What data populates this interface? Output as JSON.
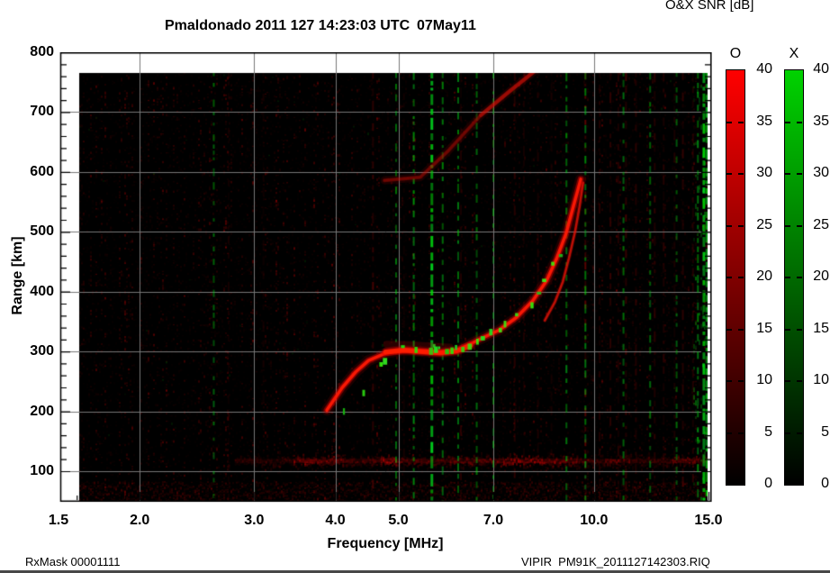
{
  "header": {
    "title_left": "Pmaldonado 2011 127 14:23:03 UTC",
    "title_right": "07May11",
    "snr_title": "O&X SNR [dB]"
  },
  "footer": {
    "left": "RxMask 00001111",
    "right": "VIPIR  PM91K_2011127142303.RIQ"
  },
  "chart_data": {
    "type": "heatmap",
    "title": "Pmaldonado 2011 127 14:23:03 UTC   07May11",
    "xlabel": "Frequency [MHz]",
    "ylabel": "Range [km]",
    "x_scale": "log",
    "x_range": [
      1.5,
      15.15
    ],
    "y_range": [
      49,
      800
    ],
    "x_ticks": [
      {
        "v": 1.5,
        "label": "1.5"
      },
      {
        "v": 2,
        "label": "2.0"
      },
      {
        "v": 3,
        "label": "3.0"
      },
      {
        "v": 4,
        "label": "4.0"
      },
      {
        "v": 5,
        "label": "5.0"
      },
      {
        "v": 7,
        "label": "7.0"
      },
      {
        "v": 10,
        "label": "10.0"
      },
      {
        "v": 15,
        "label": "15.0"
      }
    ],
    "x_minor_ticks": [
      1.6,
      1.7,
      1.8,
      1.9,
      2.2,
      2.4,
      2.6,
      2.8,
      3.2,
      3.4,
      3.6,
      3.8,
      4.2,
      4.4,
      4.6,
      4.8,
      5.5,
      6,
      6.5,
      7.5,
      8,
      8.5,
      9,
      9.5,
      11,
      12,
      13,
      14
    ],
    "y_ticks": [
      800,
      700,
      600,
      500,
      400,
      300,
      200,
      100
    ],
    "y_minor_step": 20,
    "grid": true,
    "grid_color": "#777777",
    "background_color": "#000000",
    "data_extent": {
      "f_min": 1.61,
      "f_max": 14.92,
      "km_min": 49,
      "km_max": 765
    },
    "colorbar": {
      "title_o": "O",
      "title_x": "X",
      "unit": "dB",
      "min": 0,
      "max": 40,
      "ticks": [
        40,
        35,
        30,
        25,
        20,
        15,
        10,
        5,
        0
      ],
      "o_top_color": "#ff0000",
      "x_top_color": "#00d200",
      "bottom_color": "#000000"
    },
    "traces": {
      "f_layer_o_mode": [
        [
          3.88,
          202
        ],
        [
          4.1,
          240
        ],
        [
          4.3,
          266
        ],
        [
          4.5,
          285
        ],
        [
          4.8,
          298
        ],
        [
          5.1,
          302
        ],
        [
          5.45,
          300
        ],
        [
          5.8,
          298
        ],
        [
          6.15,
          301
        ],
        [
          6.6,
          318
        ],
        [
          7.15,
          336
        ],
        [
          7.6,
          357
        ],
        [
          8.05,
          385
        ],
        [
          8.45,
          418
        ],
        [
          8.75,
          454
        ],
        [
          9.05,
          496
        ],
        [
          9.27,
          538
        ],
        [
          9.45,
          571
        ],
        [
          9.54,
          588
        ]
      ],
      "f_layer_flat_bright": [
        [
          4.78,
          299
        ],
        [
          5.1,
          302
        ],
        [
          5.45,
          300
        ],
        [
          5.8,
          298
        ],
        [
          6.15,
          301
        ],
        [
          6.45,
          310
        ]
      ],
      "f_layer_fuzz": [
        [
          4.8,
          312
        ],
        [
          5.2,
          311
        ],
        [
          5.6,
          309
        ],
        [
          6.0,
          307
        ]
      ],
      "f_layer_x_mode": [
        [
          8.4,
          352
        ],
        [
          8.7,
          382
        ],
        [
          8.95,
          416
        ],
        [
          9.15,
          456
        ],
        [
          9.35,
          500
        ],
        [
          9.5,
          542
        ],
        [
          9.62,
          582
        ]
      ],
      "second_hop": [
        [
          4.76,
          586
        ],
        [
          5.4,
          591
        ],
        [
          5.95,
          634
        ],
        [
          6.7,
          695
        ],
        [
          7.4,
          734
        ],
        [
          8.2,
          773
        ]
      ],
      "second_hop_bright": [
        [
          6.7,
          695
        ],
        [
          7.4,
          734
        ],
        [
          8.2,
          773
        ]
      ],
      "e_layer": {
        "km": 118,
        "half_width_km": 12,
        "segments": [
          [
            2.8,
            3.45,
            0.2
          ],
          [
            3.45,
            4.1,
            0.5
          ],
          [
            4.1,
            4.7,
            0.3
          ],
          [
            4.7,
            4.95,
            0.6
          ],
          [
            4.95,
            6.0,
            0.35
          ],
          [
            6.0,
            7.25,
            0.4
          ],
          [
            7.25,
            8.3,
            0.55
          ],
          [
            8.3,
            9.4,
            0.5
          ],
          [
            9.4,
            10.4,
            0.3
          ],
          [
            10.4,
            11.3,
            0.35
          ],
          [
            11.3,
            13.2,
            0.25
          ],
          [
            13.2,
            14.5,
            0.42
          ],
          [
            14.5,
            14.92,
            0.3
          ]
        ]
      },
      "x_echo_speckles": [
        [
          4.12,
          208
        ],
        [
          4.41,
          237
        ],
        [
          4.7,
          283
        ],
        [
          4.72,
          290
        ],
        [
          5.05,
          310
        ],
        [
          5.32,
          306
        ],
        [
          5.55,
          307
        ],
        [
          5.62,
          313
        ],
        [
          5.7,
          306
        ],
        [
          5.78,
          310
        ],
        [
          5.9,
          306
        ],
        [
          6.02,
          304
        ],
        [
          6.12,
          308
        ],
        [
          6.25,
          307
        ],
        [
          6.38,
          315
        ],
        [
          6.55,
          322
        ],
        [
          6.72,
          328
        ],
        [
          6.9,
          336
        ],
        [
          7.1,
          340
        ],
        [
          7.3,
          350
        ],
        [
          7.55,
          362
        ],
        [
          7.95,
          382
        ],
        [
          8.15,
          398
        ],
        [
          8.35,
          424
        ],
        [
          8.6,
          448
        ],
        [
          8.85,
          462
        ]
      ],
      "rfi_green_stripes": [
        [
          2.6,
          0.22
        ],
        [
          4.96,
          0.3
        ],
        [
          5.28,
          0.5
        ],
        [
          5.63,
          0.9
        ],
        [
          5.85,
          0.35
        ],
        [
          6.18,
          0.4
        ],
        [
          6.6,
          0.28
        ],
        [
          7.0,
          0.2
        ],
        [
          9.07,
          0.35
        ],
        [
          9.7,
          0.4
        ],
        [
          11.1,
          0.28
        ],
        [
          12.2,
          0.22
        ],
        [
          13.4,
          0.2
        ],
        [
          14.45,
          0.4
        ],
        [
          14.76,
          0.85
        ],
        [
          14.92,
          0.65
        ]
      ],
      "rfi_red_stripes": [
        [
          2.74,
          0.12
        ],
        [
          3.1,
          0.1
        ],
        [
          4.57,
          0.3
        ],
        [
          5.1,
          0.12
        ],
        [
          6.24,
          0.18
        ],
        [
          7.0,
          0.15
        ],
        [
          7.55,
          0.2
        ],
        [
          7.8,
          0.15
        ],
        [
          8.2,
          0.15
        ],
        [
          8.6,
          0.12
        ],
        [
          9.7,
          0.45
        ],
        [
          10.2,
          0.2
        ],
        [
          10.6,
          0.25
        ],
        [
          10.9,
          0.2
        ],
        [
          11.2,
          0.3
        ],
        [
          11.6,
          0.2
        ],
        [
          12.4,
          0.25
        ],
        [
          12.8,
          0.2
        ],
        [
          13.3,
          0.15
        ],
        [
          13.7,
          0.25
        ],
        [
          14.2,
          0.2
        ]
      ]
    }
  }
}
